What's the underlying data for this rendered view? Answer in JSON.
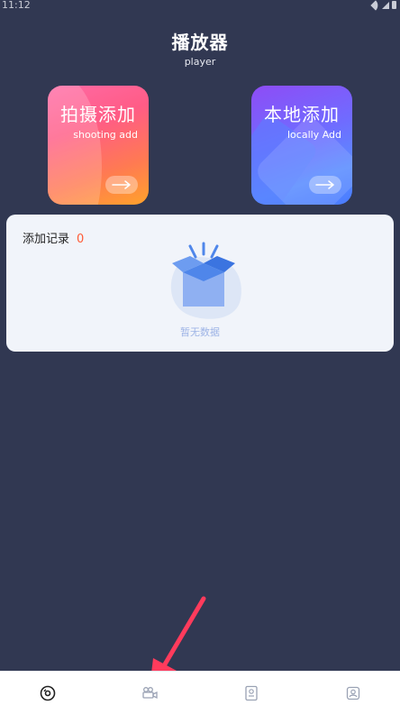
{
  "status_bar": {
    "time": "11:12"
  },
  "header": {
    "title": "播放器",
    "subtitle": "player"
  },
  "cards": {
    "shooting": {
      "title": "拍摄添加",
      "subtitle": "shooting add"
    },
    "local": {
      "title": "本地添加",
      "subtitle": "locally Add"
    }
  },
  "records": {
    "label": "添加记录",
    "count": "0",
    "empty_text": "暂无数据"
  },
  "tabbar": {
    "tabs": [
      {
        "icon": "disc-icon"
      },
      {
        "icon": "camera-icon"
      },
      {
        "icon": "document-icon"
      },
      {
        "icon": "profile-icon"
      }
    ]
  },
  "colors": {
    "background": "#313852",
    "accent_count": "#ff5a36",
    "empty_text": "#9eb4e6",
    "pointer_arrow": "#ff3b5c"
  }
}
